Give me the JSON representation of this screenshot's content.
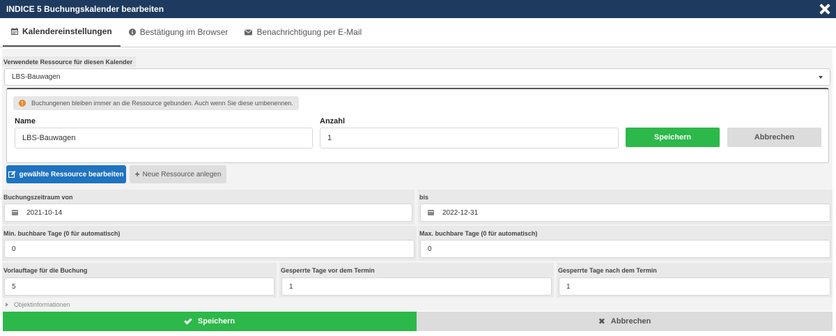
{
  "window": {
    "title": "INDICE 5 Buchungskalender bearbeiten"
  },
  "tabs": [
    {
      "label": "Kalendereinstellungen",
      "icon": "calendar-icon",
      "active": true
    },
    {
      "label": "Bestätigung im Browser",
      "icon": "info-icon",
      "active": false
    },
    {
      "label": "Benachrichtigung per E-Mail",
      "icon": "envelope-icon",
      "active": false
    }
  ],
  "resource": {
    "label": "Verwendete Ressource für diesen Kalender",
    "selected": "LBS-Bauwagen"
  },
  "edit_panel": {
    "warning": "Buchungenen bleiben immer an die Ressource gebunden. Auch wenn Sie diese umbenennen.",
    "name_label": "Name",
    "name_value": "LBS-Bauwagen",
    "count_label": "Anzahl",
    "count_value": "1",
    "save_label": "Speichern",
    "cancel_label": "Abbrechen"
  },
  "resource_actions": {
    "edit_label": "gewählte Ressource bearbeiten",
    "new_label": "Neue Ressource anlegen"
  },
  "booking": {
    "from_label": "Buchungszeitraum von",
    "from_value": "2021-10-14",
    "to_label": "bis",
    "to_value": "2022-12-31",
    "min_label": "Min. buchbare Tage (0 für automatisch)",
    "min_value": "0",
    "max_label": "Max. buchbare Tage (0 für automatisch)",
    "max_value": "0",
    "lead_label": "Vorlauftage für die Buchung",
    "lead_value": "5",
    "blocked_before_label": "Gesperrte Tage vor dem Termin",
    "blocked_before_value": "1",
    "blocked_after_label": "Gesperrte Tage nach dem Termin",
    "blocked_after_value": "1"
  },
  "object_info": {
    "label": "Objektinformationen"
  },
  "footer": {
    "save_label": "Speichern",
    "cancel_label": "Abbrechen"
  },
  "colors": {
    "titlebar": "#1f3a5f",
    "save_green": "#2db84a",
    "edit_blue": "#1f73c0",
    "warning_orange": "#e6872b"
  }
}
